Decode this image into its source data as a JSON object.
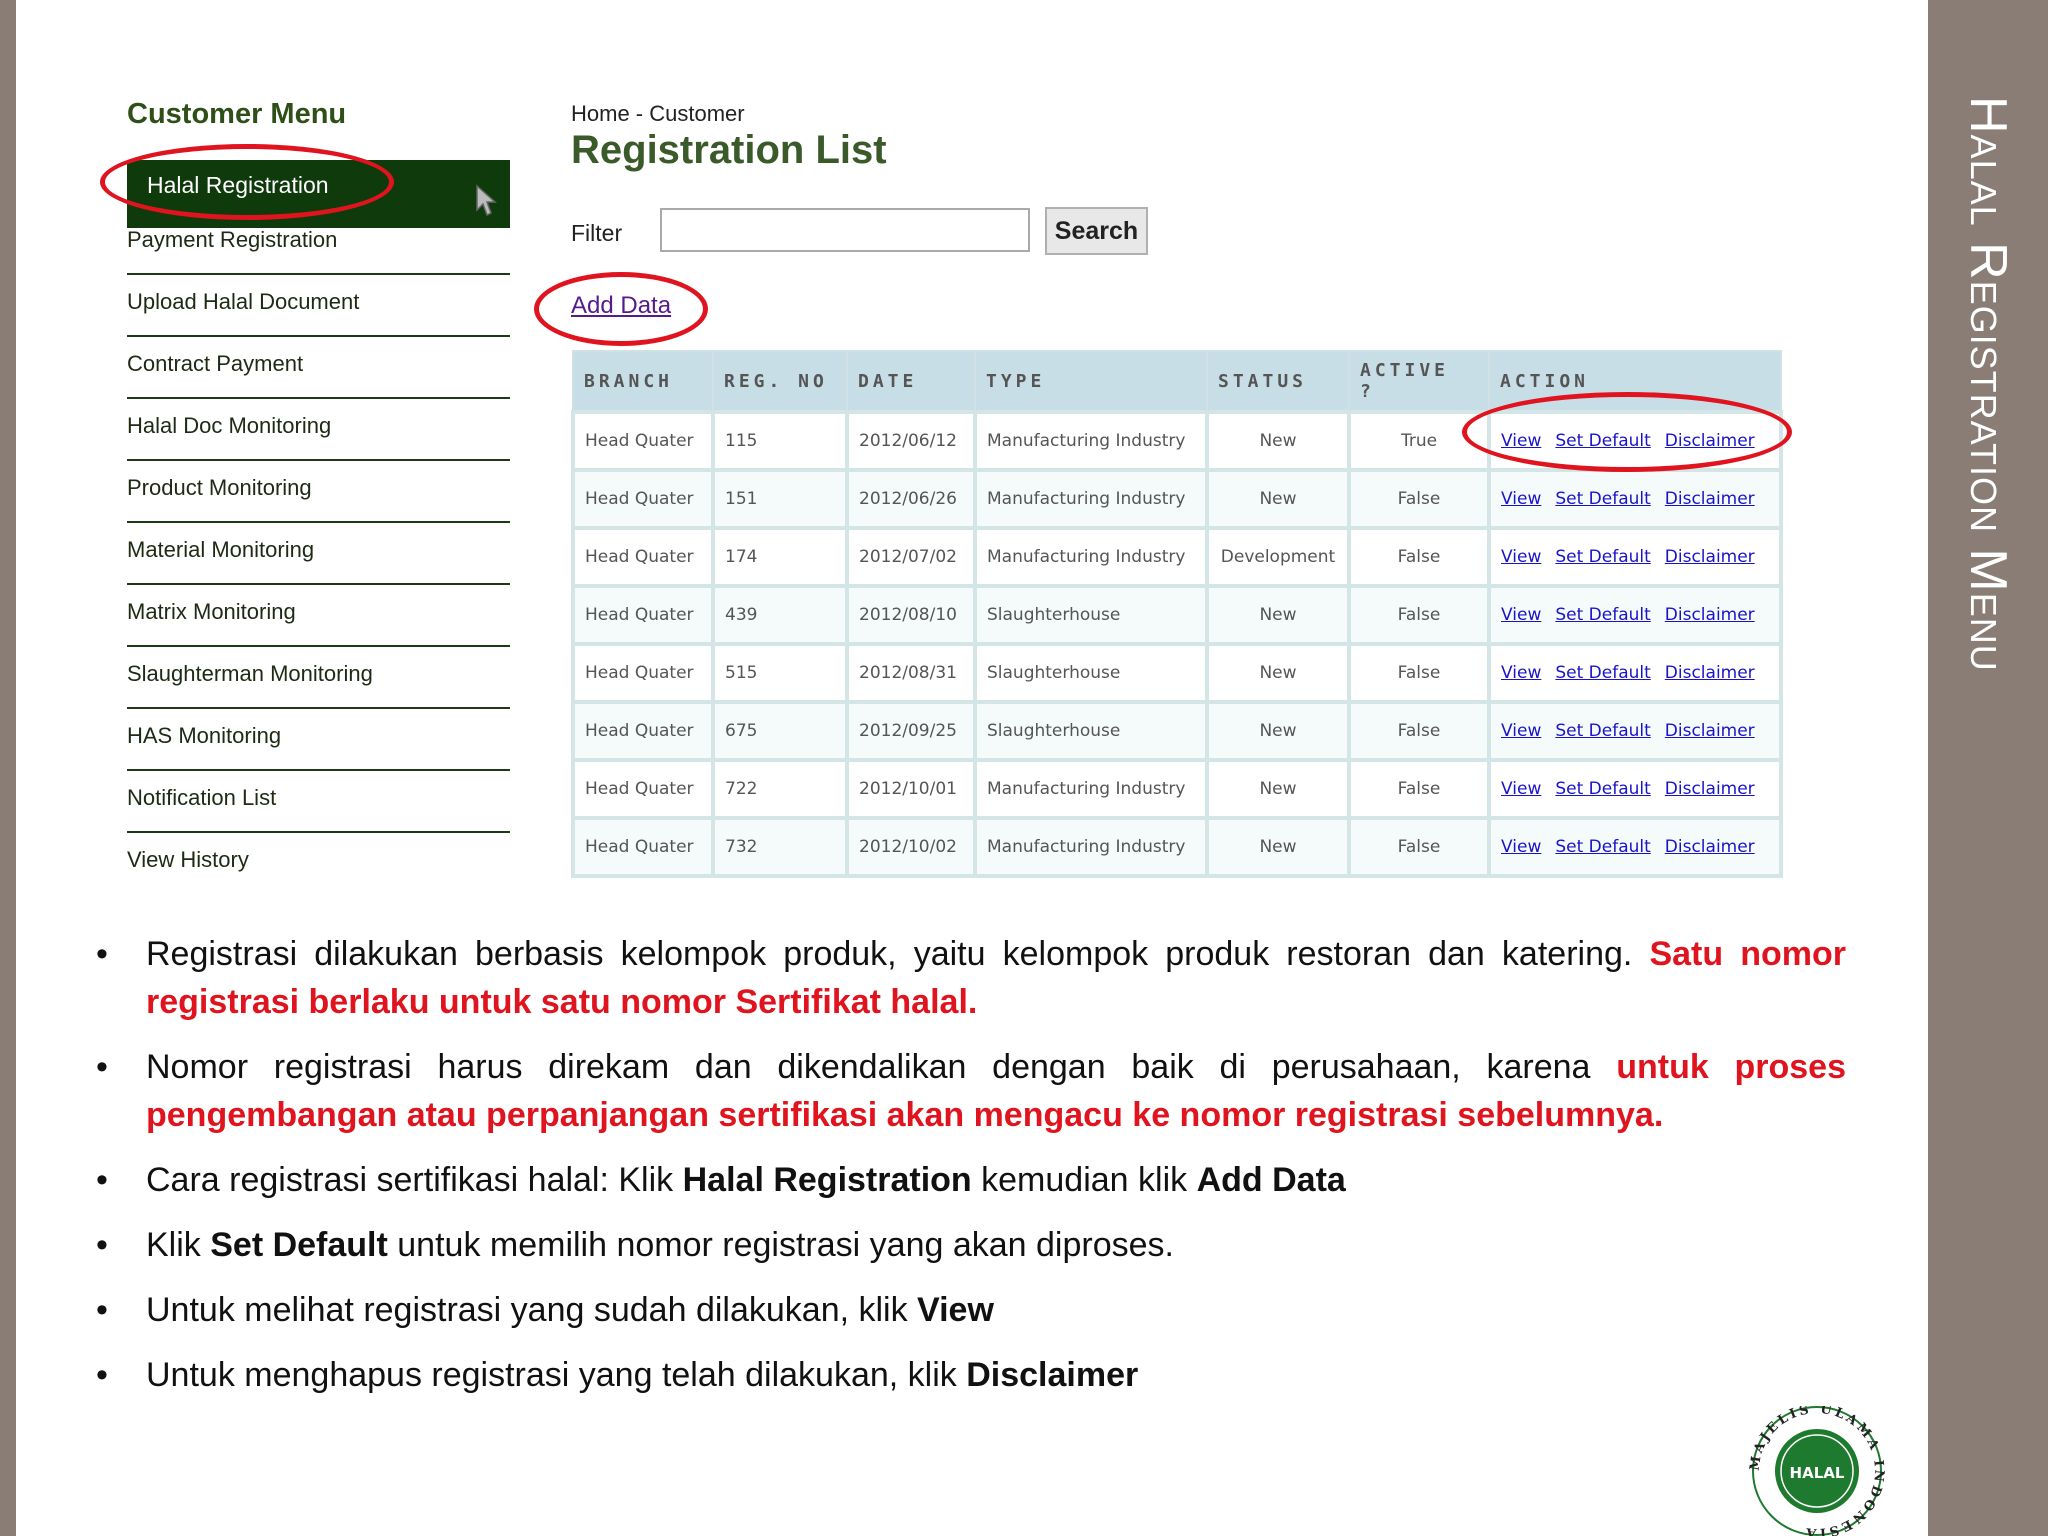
{
  "slide": {
    "title": "Halal Registration Menu"
  },
  "menu": {
    "title": "Customer Menu",
    "active": "Halal Registration",
    "items": [
      "Payment Registration",
      "Upload Halal Document",
      "Contract Payment",
      "Halal Doc Monitoring",
      "Product Monitoring",
      "Material Monitoring",
      "Matrix Monitoring",
      "Slaughterman Monitoring",
      "HAS Monitoring",
      "Notification List",
      "View History"
    ]
  },
  "main": {
    "breadcrumb": "Home - Customer",
    "heading": "Registration List",
    "filter_label": "Filter",
    "filter_value": "",
    "search_label": "Search",
    "add_data": "Add Data"
  },
  "table": {
    "columns": [
      "BRANCH",
      "REG. NO",
      "DATE",
      "TYPE",
      "STATUS",
      "ACTIVE ?",
      "ACTION"
    ],
    "actions": {
      "view": "View",
      "set_default": "Set Default",
      "disclaimer": "Disclaimer"
    },
    "rows": [
      {
        "branch": "Head Quater",
        "reg_no": "115",
        "date": "2012/06/12",
        "type": "Manufacturing Industry",
        "status": "New",
        "active": "True"
      },
      {
        "branch": "Head Quater",
        "reg_no": "151",
        "date": "2012/06/26",
        "type": "Manufacturing Industry",
        "status": "New",
        "active": "False"
      },
      {
        "branch": "Head Quater",
        "reg_no": "174",
        "date": "2012/07/02",
        "type": "Manufacturing Industry",
        "status": "Development",
        "active": "False"
      },
      {
        "branch": "Head Quater",
        "reg_no": "439",
        "date": "2012/08/10",
        "type": "Slaughterhouse",
        "status": "New",
        "active": "False"
      },
      {
        "branch": "Head Quater",
        "reg_no": "515",
        "date": "2012/08/31",
        "type": "Slaughterhouse",
        "status": "New",
        "active": "False"
      },
      {
        "branch": "Head Quater",
        "reg_no": "675",
        "date": "2012/09/25",
        "type": "Slaughterhouse",
        "status": "New",
        "active": "False"
      },
      {
        "branch": "Head Quater",
        "reg_no": "722",
        "date": "2012/10/01",
        "type": "Manufacturing Industry",
        "status": "New",
        "active": "False"
      },
      {
        "branch": "Head Quater",
        "reg_no": "732",
        "date": "2012/10/02",
        "type": "Manufacturing Industry",
        "status": "New",
        "active": "False"
      }
    ]
  },
  "notes": [
    {
      "text": "Registrasi dilakukan berbasis kelompok produk, yaitu kelompok produk restoran dan katering. ",
      "highlight": "Satu nomor registrasi berlaku untuk satu nomor Sertifikat halal."
    },
    {
      "text": "Nomor registrasi harus direkam dan dikendalikan dengan baik di perusahaan, karena ",
      "highlight": "untuk proses pengembangan atau perpanjangan sertifikasi akan mengacu ke nomor registrasi sebelumnya."
    },
    {
      "pre": "Cara registrasi sertifikasi halal: Klik ",
      "bold1": "Halal Registration",
      "mid": " kemudian klik ",
      "bold2": "Add Data"
    },
    {
      "pre": "Klik ",
      "bold": "Set Default",
      "post": " untuk memilih nomor registrasi yang akan diproses."
    },
    {
      "pre": "Untuk melihat registrasi yang sudah dilakukan, klik ",
      "bold": "View"
    },
    {
      "pre": "Untuk menghapus registrasi yang telah dilakukan, klik ",
      "bold": "Disclaimer"
    }
  ],
  "logo": {
    "ring_text": "MAJELIS ULAMA INDONESIA",
    "center_text": "HALAL",
    "color": "#1e7a2e"
  },
  "colors": {
    "accent_red": "#e0141e",
    "menu_green": "#0f3a0c",
    "header_teal": "#c8dee6",
    "side_bar": "#8a7d75"
  }
}
